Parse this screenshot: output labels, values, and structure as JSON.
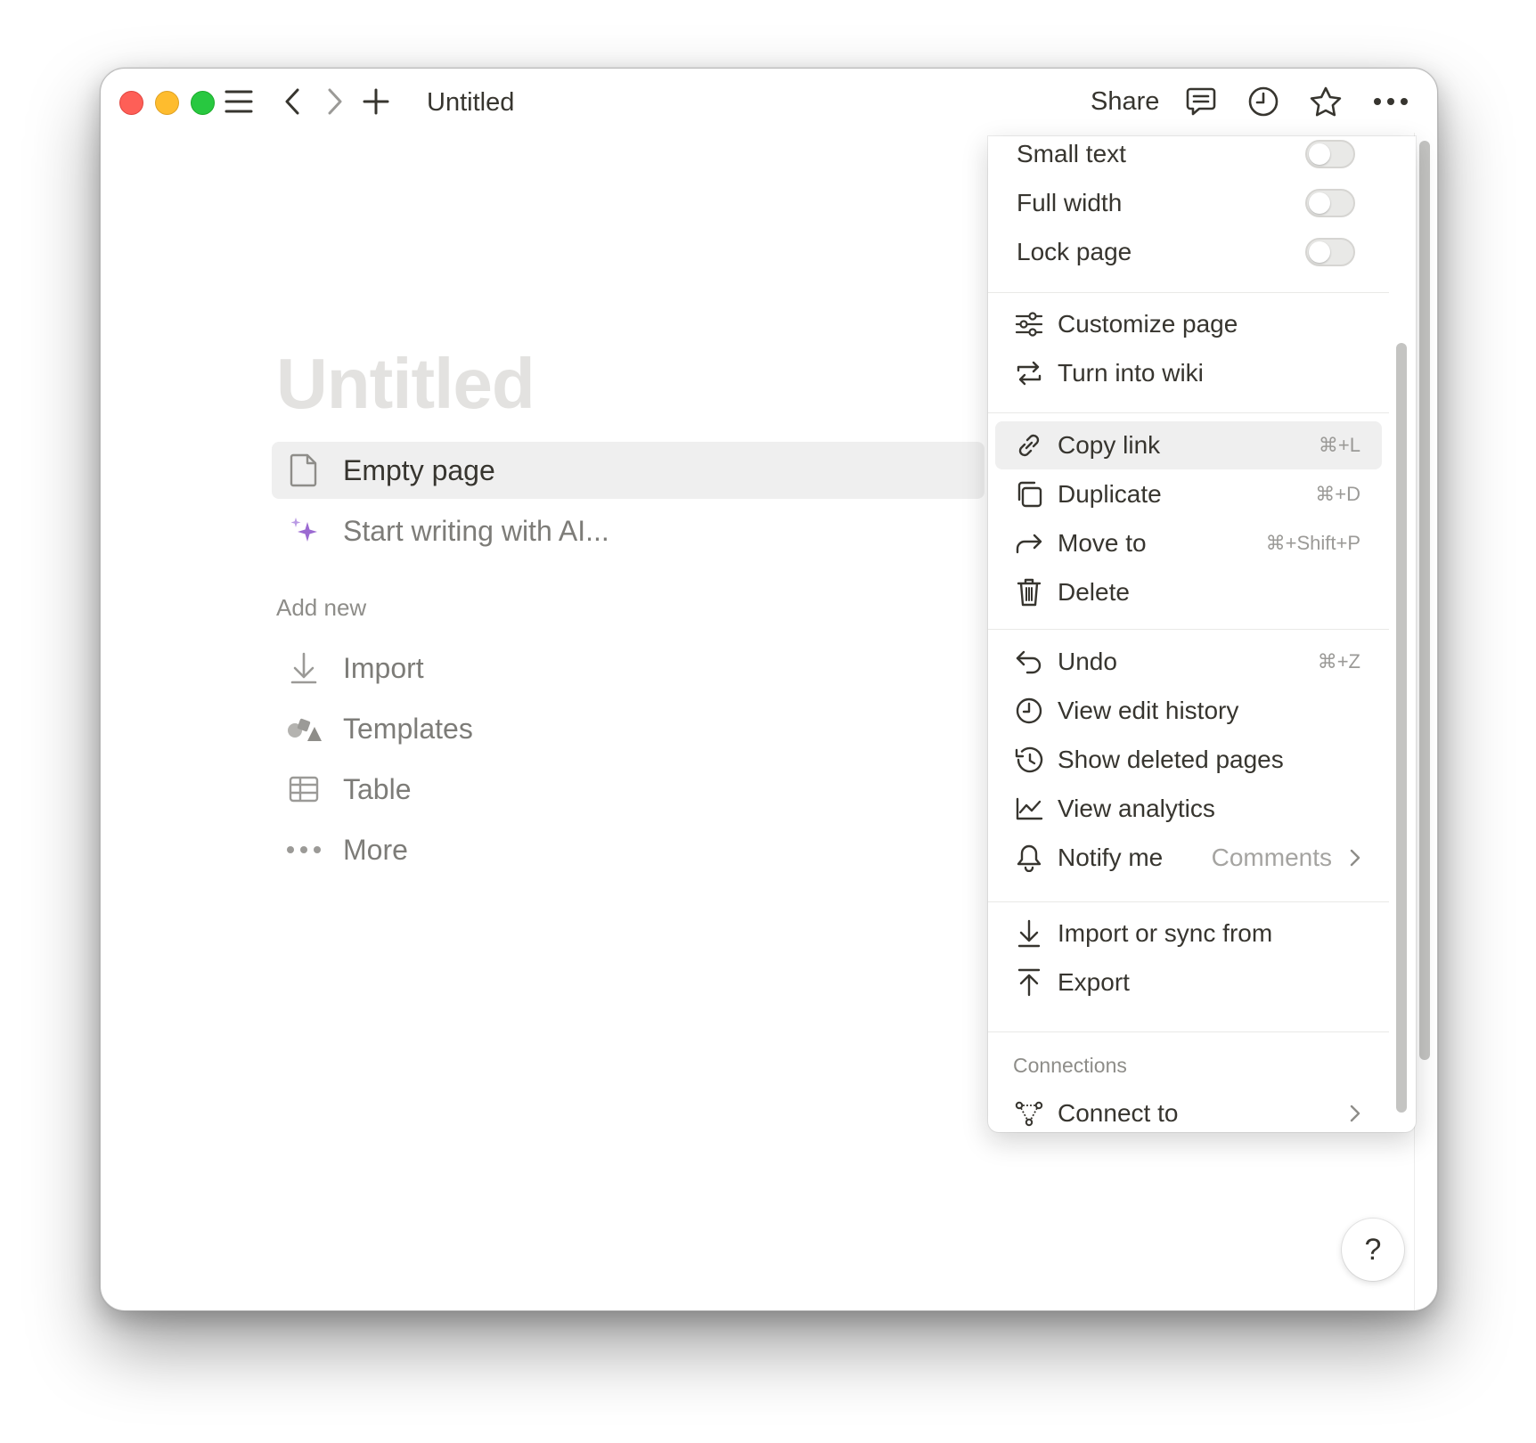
{
  "titlebar": {
    "title": "Untitled",
    "share_label": "Share",
    "icons": [
      "menu-icon",
      "back-icon",
      "forward-icon",
      "plus-icon",
      "comment-icon",
      "clock-icon",
      "star-icon",
      "more-icon"
    ]
  },
  "page": {
    "title_placeholder": "Untitled",
    "options": [
      {
        "label": "Empty page",
        "icon": "page-icon"
      },
      {
        "label": "Start writing with AI...",
        "icon": "sparkle-icon"
      }
    ],
    "add_new_label": "Add new",
    "add_new": [
      {
        "label": "Import",
        "icon": "import-icon"
      },
      {
        "label": "Templates",
        "icon": "templates-icon"
      },
      {
        "label": "Table",
        "icon": "table-icon"
      },
      {
        "label": "More",
        "icon": "more-icon"
      }
    ]
  },
  "menu": {
    "toggles": [
      {
        "label": "Small text",
        "on": false
      },
      {
        "label": "Full width",
        "on": false
      },
      {
        "label": "Lock page",
        "on": false
      }
    ],
    "page_actions": [
      {
        "label": "Customize page",
        "icon": "customize-icon"
      },
      {
        "label": "Turn into wiki",
        "icon": "wiki-icon"
      }
    ],
    "edit_actions": [
      {
        "label": "Copy link",
        "shortcut": "⌘+L",
        "icon": "link-icon"
      },
      {
        "label": "Duplicate",
        "shortcut": "⌘+D",
        "icon": "duplicate-icon"
      },
      {
        "label": "Move to",
        "shortcut": "⌘+Shift+P",
        "icon": "move-icon"
      },
      {
        "label": "Delete",
        "icon": "trash-icon"
      }
    ],
    "history_actions": [
      {
        "label": "Undo",
        "shortcut": "⌘+Z",
        "icon": "undo-icon"
      },
      {
        "label": "View edit history",
        "icon": "history-icon"
      },
      {
        "label": "Show deleted pages",
        "icon": "deleted-icon"
      },
      {
        "label": "View analytics",
        "icon": "analytics-icon"
      },
      {
        "label": "Notify me",
        "value": "Comments",
        "icon": "bell-icon"
      }
    ],
    "io_actions": [
      {
        "label": "Import or sync from",
        "icon": "import-icon"
      },
      {
        "label": "Export",
        "icon": "export-icon"
      }
    ],
    "connections_label": "Connections",
    "connect": {
      "label": "Connect to",
      "icon": "connect-icon"
    }
  },
  "help_label": "?",
  "colors": {
    "highlight": "#efefef",
    "text": "#37352f",
    "muted": "#7d7c78",
    "sparkle": "#9b6ad1"
  }
}
